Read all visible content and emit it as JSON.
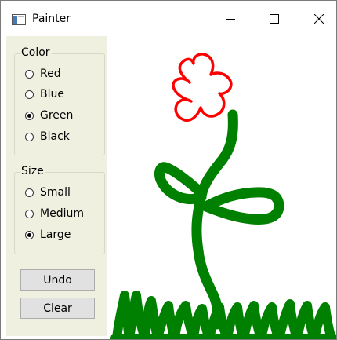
{
  "window": {
    "title": "Painter"
  },
  "title_bar_buttons": [
    "minimize-icon",
    "maximize-icon",
    "close-icon"
  ],
  "color_group": {
    "legend": "Color",
    "options": [
      {
        "label": "Red",
        "selected": false
      },
      {
        "label": "Blue",
        "selected": false
      },
      {
        "label": "Green",
        "selected": true
      },
      {
        "label": "Black",
        "selected": false
      }
    ]
  },
  "size_group": {
    "legend": "Size",
    "options": [
      {
        "label": "Small",
        "selected": false
      },
      {
        "label": "Medium",
        "selected": false
      },
      {
        "label": "Large",
        "selected": true
      }
    ]
  },
  "buttons": {
    "undo": "Undo",
    "clear": "Clear"
  },
  "colors": {
    "sidebar_bg": "#f0f0e0",
    "stroke_red": "#ff0000",
    "stroke_green": "#008000"
  }
}
